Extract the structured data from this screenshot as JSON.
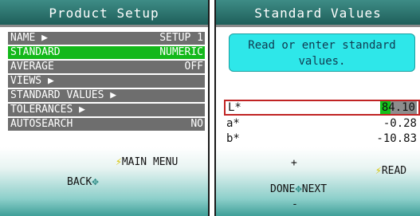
{
  "left": {
    "title": "Product Setup",
    "menu": [
      {
        "label": "NAME ▶",
        "value": "SETUP 1",
        "selected": false
      },
      {
        "label": "STANDARD",
        "value": "NUMERIC",
        "selected": true
      },
      {
        "label": "AVERAGE",
        "value": "OFF",
        "selected": false
      },
      {
        "label": "VIEWS ▶",
        "value": "",
        "selected": false
      },
      {
        "label": "STANDARD VALUES ▶",
        "value": "",
        "selected": false
      },
      {
        "label": "TOLERANCES ▶",
        "value": "",
        "selected": false
      },
      {
        "label": "AUTOSEARCH",
        "value": "NO",
        "selected": false
      }
    ],
    "footer": {
      "main_menu": "MAIN MENU",
      "back": "BACK"
    }
  },
  "right": {
    "title": "Standard Values",
    "hint": "Read or enter standard values.",
    "values": [
      {
        "label": "L*",
        "value": "84.10",
        "selected": true
      },
      {
        "label": "a*",
        "value": "-0.28",
        "selected": false
      },
      {
        "label": "b*",
        "value": "-10.83",
        "selected": false
      }
    ],
    "footer": {
      "plus": "+",
      "done": "DONE",
      "next": "NEXT",
      "minus": "-",
      "read": "READ"
    }
  },
  "icons": {
    "bolt": "lightning-bolt-icon",
    "diamond": "four-way-arrow-icon"
  },
  "colors": {
    "title": "#2f7a74",
    "selected": "#13b81a",
    "row": "#6e6e6e",
    "hint": "#2ee7e9",
    "accent": "#d8c400",
    "highlight_border": "#c02323"
  }
}
